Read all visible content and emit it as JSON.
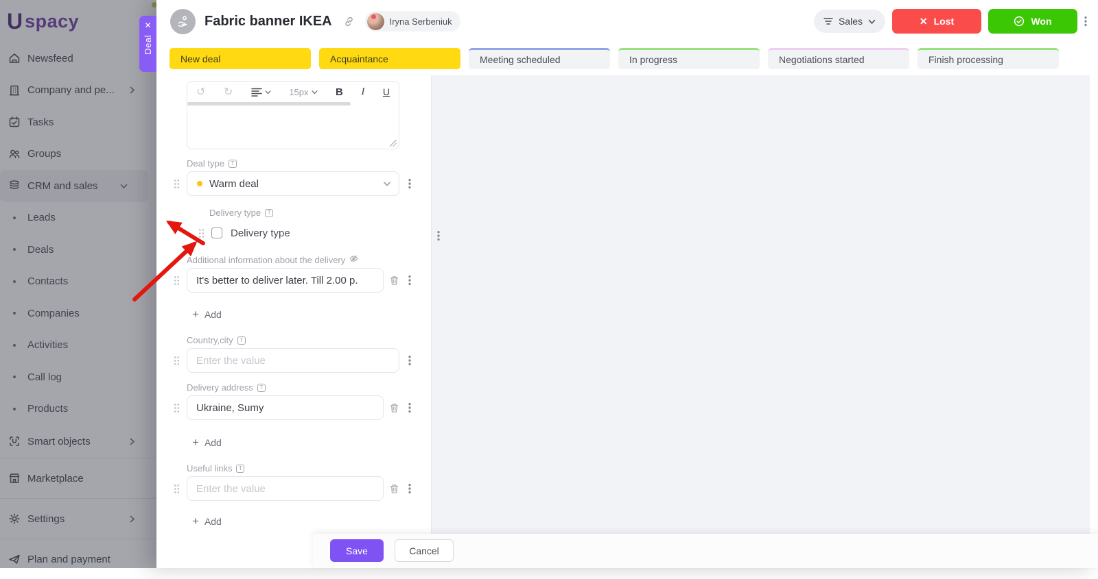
{
  "colors": {
    "brand_purple": "#7E52F3",
    "deal_tab_purple": "#8A5CF6",
    "stage_done_yellow": "#FFD912",
    "lost_red": "#FB4C4C",
    "won_green": "#3CC705",
    "warm_deal_dot": "#FCC419",
    "annotation_arrow_red": "#E3170E"
  },
  "logo": {
    "mark": "U",
    "text": "spacy"
  },
  "deal_tab": {
    "label": "Deal"
  },
  "icons": {
    "close": "✕",
    "undo": "↺",
    "redo": "↻",
    "field_type": "T"
  },
  "sidebar": {
    "items": [
      {
        "label": "Newsfeed"
      },
      {
        "label": "Company and pe..."
      },
      {
        "label": "Tasks"
      },
      {
        "label": "Groups"
      },
      {
        "label": "CRM and sales"
      }
    ],
    "crm_subitems": [
      "Leads",
      "Deals",
      "Contacts",
      "Companies",
      "Activities",
      "Call log",
      "Products"
    ],
    "lower_items": [
      {
        "label": "Smart objects"
      },
      {
        "label": "Marketplace"
      },
      {
        "label": "Settings"
      },
      {
        "label": "Plan and payment"
      }
    ]
  },
  "header": {
    "title": "Fabric banner IKEA",
    "owner": "Iryna Serbeniuk",
    "pipeline_label": "Sales",
    "lost_label": "Lost",
    "won_label": "Won"
  },
  "stages": [
    {
      "label": "New deal",
      "state": "done"
    },
    {
      "label": "Acquaintance",
      "state": "done"
    },
    {
      "label": "Meeting scheduled",
      "accent": "#8FA4E4"
    },
    {
      "label": "In progress",
      "accent": "#96E37E"
    },
    {
      "label": "Negotiations started",
      "accent": "#F0CDF2"
    },
    {
      "label": "Finish processing",
      "accent": "#96E37E"
    }
  ],
  "editor": {
    "font_size_value": "15px",
    "bold": "B",
    "italic": "I",
    "underline": "U"
  },
  "form": {
    "add_plus": "+",
    "add_label": "Add",
    "deal_type": {
      "label": "Deal type",
      "value": "Warm deal"
    },
    "delivery_type": {
      "label": "Delivery type",
      "checkbox_label": "Delivery type",
      "checked": false
    },
    "additional_info": {
      "label": "Additional information about the delivery",
      "value": "It's better to deliver later. Till 2.00 p."
    },
    "country_city": {
      "label": "Country,city",
      "placeholder": "Enter the value"
    },
    "delivery_address": {
      "label": "Delivery address",
      "value": "Ukraine, Sumy"
    },
    "useful_links": {
      "label": "Useful links",
      "placeholder": "Enter the value"
    }
  },
  "footer": {
    "save": "Save",
    "cancel": "Cancel"
  }
}
